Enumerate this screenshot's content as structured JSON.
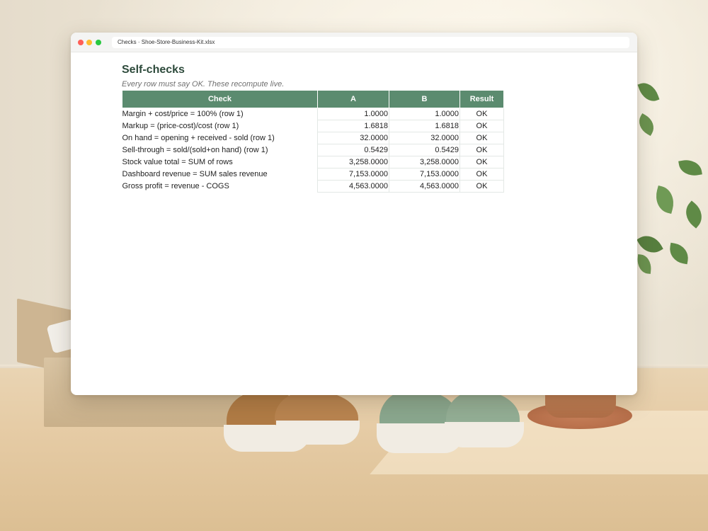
{
  "window": {
    "address": "Checks · Shoe-Store-Business-Kit.xlsx"
  },
  "sheet": {
    "title": "Self-checks",
    "subtitle": "Every row must say OK. These recompute live.",
    "columns": [
      "Check",
      "A",
      "B",
      "Result"
    ],
    "rows": [
      {
        "check": "Margin + cost/price = 100% (row 1)",
        "a": "1.0000",
        "b": "1.0000",
        "result": "OK"
      },
      {
        "check": "Markup = (price-cost)/cost (row 1)",
        "a": "1.6818",
        "b": "1.6818",
        "result": "OK"
      },
      {
        "check": "On hand = opening + received - sold (row 1)",
        "a": "32.0000",
        "b": "32.0000",
        "result": "OK"
      },
      {
        "check": "Sell-through = sold/(sold+on hand) (row 1)",
        "a": "0.5429",
        "b": "0.5429",
        "result": "OK"
      },
      {
        "check": "Stock value total = SUM of rows",
        "a": "3,258.0000",
        "b": "3,258.0000",
        "result": "OK"
      },
      {
        "check": "Dashboard revenue = SUM sales revenue",
        "a": "7,153.0000",
        "b": "7,153.0000",
        "result": "OK"
      },
      {
        "check": "Gross profit = revenue - COGS",
        "a": "4,563.0000",
        "b": "4,563.0000",
        "result": "OK"
      }
    ]
  },
  "colors": {
    "header_fill": "#5b8b6f",
    "title_color": "#2d4a3b"
  }
}
